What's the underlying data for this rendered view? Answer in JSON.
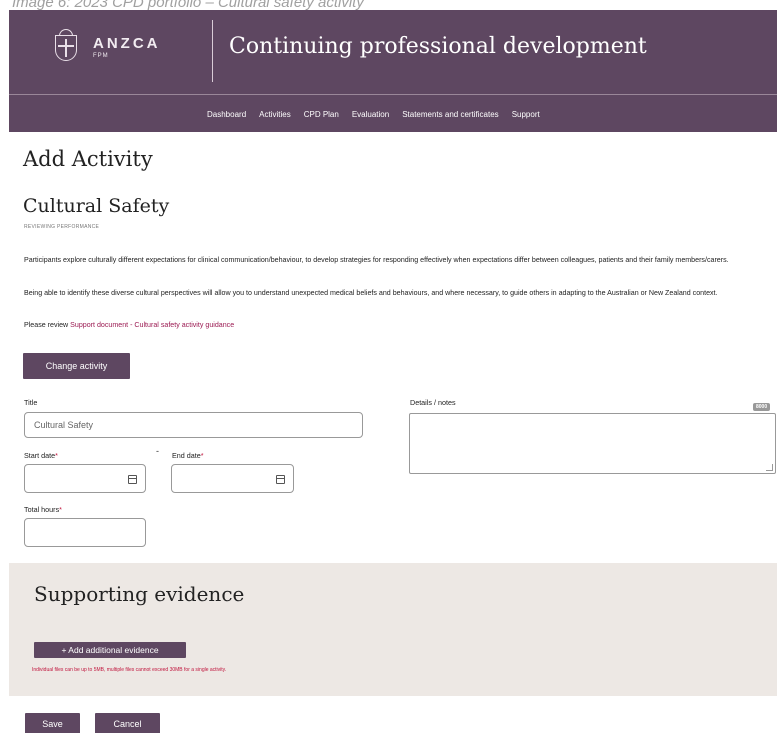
{
  "caption": "Image 6: 2023 CPD portfolio – Cultural safety activity",
  "colors": {
    "brand": "#5e4761",
    "link": "#9b1a52",
    "required": "#c0143c",
    "evidence_bg": "#ede8e4"
  },
  "header": {
    "logo_name": "ANZCA",
    "logo_sub": "FPM",
    "site_title": "Continuing professional development",
    "nav": [
      "Dashboard",
      "Activities",
      "CPD Plan",
      "Evaluation",
      "Statements and certificates",
      "Support"
    ]
  },
  "page": {
    "title": "Add Activity",
    "section_title": "Cultural Safety",
    "section_sub": "REVIEWING PERFORMANCE",
    "para1": "Participants explore culturally different expectations for clinical communication/behaviour, to develop strategies for responding effectively when expectations differ between colleagues, patients and their family members/carers.",
    "para2": "Being able to identify these diverse cultural perspectives will allow you to understand unexpected medical beliefs and behaviours, and where necessary, to guide others in adapting to the Australian or New Zealand context.",
    "review_prefix": "Please review ",
    "review_link": "Support document - Cultural safety activity guidance",
    "change_button": "Change activity"
  },
  "form": {
    "title_label": "Title",
    "title_value": "Cultural Safety",
    "start_label": "Start date",
    "end_label": "End date",
    "required_mark": "*",
    "date_separator": "-",
    "hours_label": "Total hours",
    "details_label": "Details / notes",
    "details_counter": "8000"
  },
  "evidence": {
    "title": "Supporting evidence",
    "add_button": "+ Add additional evidence",
    "note": "Individual files can be up to 5MB, multiple files cannot exceed 30MB for a single activity."
  },
  "actions": {
    "save": "Save",
    "cancel": "Cancel"
  },
  "icons": {
    "calendar": "calendar-icon",
    "crest": "anzca-crest-icon"
  }
}
